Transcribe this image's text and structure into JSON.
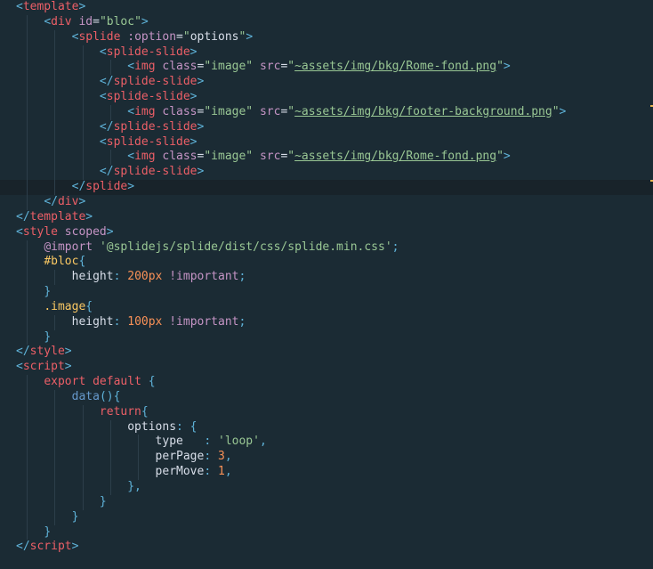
{
  "editor": {
    "lines": [
      [
        {
          "c": "p",
          "t": "<"
        },
        {
          "c": "t",
          "t": "template"
        },
        {
          "c": "p",
          "t": ">"
        }
      ],
      [
        {
          "c": "w",
          "t": "    "
        },
        {
          "c": "p",
          "t": "<"
        },
        {
          "c": "t",
          "t": "div"
        },
        {
          "c": "w",
          "t": " "
        },
        {
          "c": "a",
          "t": "id"
        },
        {
          "c": "eq",
          "t": "="
        },
        {
          "c": "s",
          "t": "\"bloc\""
        },
        {
          "c": "p",
          "t": ">"
        }
      ],
      [
        {
          "c": "w",
          "t": "        "
        },
        {
          "c": "p",
          "t": "<"
        },
        {
          "c": "t",
          "t": "splide"
        },
        {
          "c": "w",
          "t": " "
        },
        {
          "c": "a",
          "t": ":option"
        },
        {
          "c": "eq",
          "t": "="
        },
        {
          "c": "s",
          "t": "\""
        },
        {
          "c": "pr",
          "t": "options"
        },
        {
          "c": "s",
          "t": "\""
        },
        {
          "c": "p",
          "t": ">"
        }
      ],
      [
        {
          "c": "w",
          "t": "            "
        },
        {
          "c": "p",
          "t": "<"
        },
        {
          "c": "t",
          "t": "splide-slide"
        },
        {
          "c": "p",
          "t": ">"
        }
      ],
      [
        {
          "c": "w",
          "t": "                "
        },
        {
          "c": "p",
          "t": "<"
        },
        {
          "c": "t",
          "t": "img"
        },
        {
          "c": "w",
          "t": " "
        },
        {
          "c": "a",
          "t": "class"
        },
        {
          "c": "eq",
          "t": "="
        },
        {
          "c": "s",
          "t": "\"image\""
        },
        {
          "c": "w",
          "t": " "
        },
        {
          "c": "a",
          "t": "src"
        },
        {
          "c": "eq",
          "t": "="
        },
        {
          "c": "s",
          "t": "\""
        },
        {
          "c": "u",
          "t": "~assets/img/bkg/Rome-fond.png"
        },
        {
          "c": "s",
          "t": "\""
        },
        {
          "c": "p",
          "t": ">"
        }
      ],
      [
        {
          "c": "w",
          "t": "            "
        },
        {
          "c": "p",
          "t": "</"
        },
        {
          "c": "t",
          "t": "splide-slide"
        },
        {
          "c": "p",
          "t": ">"
        }
      ],
      [
        {
          "c": "w",
          "t": "            "
        },
        {
          "c": "p",
          "t": "<"
        },
        {
          "c": "t",
          "t": "splide-slide"
        },
        {
          "c": "p",
          "t": ">"
        }
      ],
      [
        {
          "c": "w",
          "t": "                "
        },
        {
          "c": "p",
          "t": "<"
        },
        {
          "c": "t",
          "t": "img"
        },
        {
          "c": "w",
          "t": " "
        },
        {
          "c": "a",
          "t": "class"
        },
        {
          "c": "eq",
          "t": "="
        },
        {
          "c": "s",
          "t": "\"image\""
        },
        {
          "c": "w",
          "t": " "
        },
        {
          "c": "a",
          "t": "src"
        },
        {
          "c": "eq",
          "t": "="
        },
        {
          "c": "s",
          "t": "\""
        },
        {
          "c": "u",
          "t": "~assets/img/bkg/footer-background.png"
        },
        {
          "c": "s",
          "t": "\""
        },
        {
          "c": "p",
          "t": ">"
        }
      ],
      [
        {
          "c": "w",
          "t": "            "
        },
        {
          "c": "p",
          "t": "</"
        },
        {
          "c": "t",
          "t": "splide-slide"
        },
        {
          "c": "p",
          "t": ">"
        }
      ],
      [
        {
          "c": "w",
          "t": "            "
        },
        {
          "c": "p",
          "t": "<"
        },
        {
          "c": "t",
          "t": "splide-slide"
        },
        {
          "c": "p",
          "t": ">"
        }
      ],
      [
        {
          "c": "w",
          "t": "                "
        },
        {
          "c": "p",
          "t": "<"
        },
        {
          "c": "t",
          "t": "img"
        },
        {
          "c": "w",
          "t": " "
        },
        {
          "c": "a",
          "t": "class"
        },
        {
          "c": "eq",
          "t": "="
        },
        {
          "c": "s",
          "t": "\"image\""
        },
        {
          "c": "w",
          "t": " "
        },
        {
          "c": "a",
          "t": "src"
        },
        {
          "c": "eq",
          "t": "="
        },
        {
          "c": "s",
          "t": "\""
        },
        {
          "c": "u",
          "t": "~assets/img/bkg/Rome-fond.png"
        },
        {
          "c": "s",
          "t": "\""
        },
        {
          "c": "p",
          "t": ">"
        }
      ],
      [
        {
          "c": "w",
          "t": "            "
        },
        {
          "c": "p",
          "t": "</"
        },
        {
          "c": "t",
          "t": "splide-slide"
        },
        {
          "c": "p",
          "t": ">"
        }
      ],
      [
        {
          "c": "w",
          "t": "        "
        },
        {
          "c": "p",
          "t": "</"
        },
        {
          "c": "t",
          "t": "splide"
        },
        {
          "c": "p",
          "t": ">"
        }
      ],
      [
        {
          "c": "w",
          "t": "    "
        },
        {
          "c": "p",
          "t": "</"
        },
        {
          "c": "t",
          "t": "div"
        },
        {
          "c": "p",
          "t": ">"
        }
      ],
      [
        {
          "c": "p",
          "t": "</"
        },
        {
          "c": "t",
          "t": "template"
        },
        {
          "c": "p",
          "t": ">"
        }
      ],
      [
        {
          "c": "p",
          "t": "<"
        },
        {
          "c": "t",
          "t": "style"
        },
        {
          "c": "w",
          "t": " "
        },
        {
          "c": "a",
          "t": "scoped"
        },
        {
          "c": "p",
          "t": ">"
        }
      ],
      [
        {
          "c": "w",
          "t": "    "
        },
        {
          "c": "k",
          "t": "@import"
        },
        {
          "c": "w",
          "t": " "
        },
        {
          "c": "s",
          "t": "'@splidejs/splide/dist/css/splide.min.css'"
        },
        {
          "c": "pu",
          "t": ";"
        }
      ],
      [
        {
          "c": "w",
          "t": "    "
        },
        {
          "c": "sel",
          "t": "#bloc"
        },
        {
          "c": "pu",
          "t": "{"
        }
      ],
      [
        {
          "c": "w",
          "t": "        "
        },
        {
          "c": "pr",
          "t": "height"
        },
        {
          "c": "pu",
          "t": ": "
        },
        {
          "c": "n",
          "t": "200px"
        },
        {
          "c": "w",
          "t": " "
        },
        {
          "c": "k",
          "t": "!important"
        },
        {
          "c": "pu",
          "t": ";"
        }
      ],
      [
        {
          "c": "w",
          "t": "    "
        },
        {
          "c": "pu",
          "t": "}"
        }
      ],
      [
        {
          "c": "w",
          "t": "    "
        },
        {
          "c": "sel",
          "t": ".image"
        },
        {
          "c": "pu",
          "t": "{"
        }
      ],
      [
        {
          "c": "w",
          "t": "        "
        },
        {
          "c": "pr",
          "t": "height"
        },
        {
          "c": "pu",
          "t": ": "
        },
        {
          "c": "n",
          "t": "100px"
        },
        {
          "c": "w",
          "t": " "
        },
        {
          "c": "k",
          "t": "!important"
        },
        {
          "c": "pu",
          "t": ";"
        }
      ],
      [
        {
          "c": "w",
          "t": "    "
        },
        {
          "c": "pu",
          "t": "}"
        }
      ],
      [
        {
          "c": "p",
          "t": "</"
        },
        {
          "c": "t",
          "t": "style"
        },
        {
          "c": "p",
          "t": ">"
        }
      ],
      [
        {
          "c": "p",
          "t": "<"
        },
        {
          "c": "t",
          "t": "script"
        },
        {
          "c": "p",
          "t": ">"
        }
      ],
      [
        {
          "c": "w",
          "t": "    "
        },
        {
          "c": "t",
          "t": "export"
        },
        {
          "c": "w",
          "t": " "
        },
        {
          "c": "t",
          "t": "default"
        },
        {
          "c": "w",
          "t": " "
        },
        {
          "c": "pu",
          "t": "{"
        }
      ],
      [
        {
          "c": "w",
          "t": "        "
        },
        {
          "c": "f",
          "t": "data"
        },
        {
          "c": "pu",
          "t": "(){"
        }
      ],
      [
        {
          "c": "w",
          "t": "            "
        },
        {
          "c": "t",
          "t": "return"
        },
        {
          "c": "pu",
          "t": "{"
        }
      ],
      [
        {
          "c": "w",
          "t": "                "
        },
        {
          "c": "pr",
          "t": "options"
        },
        {
          "c": "pu",
          "t": ": {"
        }
      ],
      [
        {
          "c": "w",
          "t": "                    "
        },
        {
          "c": "pr",
          "t": "type   "
        },
        {
          "c": "pu",
          "t": ": "
        },
        {
          "c": "s",
          "t": "'loop'"
        },
        {
          "c": "pu",
          "t": ","
        }
      ],
      [
        {
          "c": "w",
          "t": "                    "
        },
        {
          "c": "pr",
          "t": "perPage"
        },
        {
          "c": "pu",
          "t": ": "
        },
        {
          "c": "n",
          "t": "3"
        },
        {
          "c": "pu",
          "t": ","
        }
      ],
      [
        {
          "c": "w",
          "t": "                    "
        },
        {
          "c": "pr",
          "t": "perMove"
        },
        {
          "c": "pu",
          "t": ": "
        },
        {
          "c": "n",
          "t": "1"
        },
        {
          "c": "pu",
          "t": ","
        }
      ],
      [
        {
          "c": "w",
          "t": "                "
        },
        {
          "c": "pu",
          "t": "},"
        }
      ],
      [
        {
          "c": "w",
          "t": "            "
        },
        {
          "c": "pu",
          "t": "}"
        }
      ],
      [
        {
          "c": "w",
          "t": "        "
        },
        {
          "c": "pu",
          "t": "}"
        }
      ],
      [
        {
          "c": "w",
          "t": "    "
        },
        {
          "c": "pu",
          "t": "}"
        }
      ],
      [
        {
          "c": "p",
          "t": "</"
        },
        {
          "c": "t",
          "t": "script"
        },
        {
          "c": "p",
          "t": ">"
        }
      ]
    ],
    "active_line": 12
  }
}
